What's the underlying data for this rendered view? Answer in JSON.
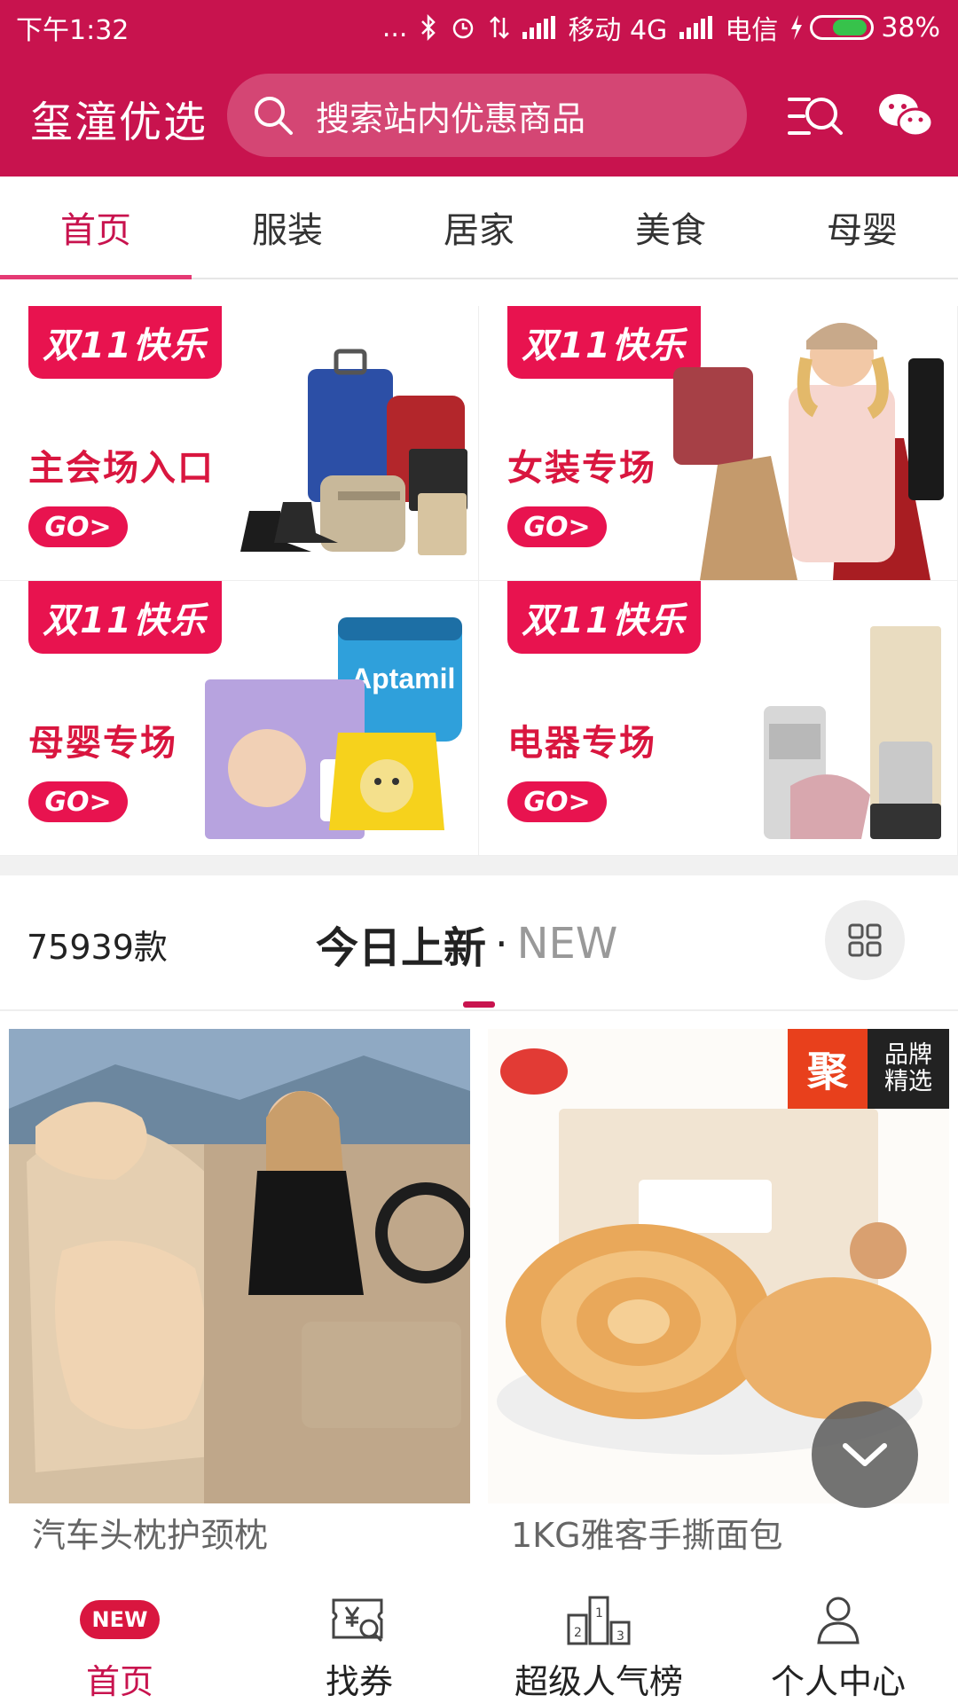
{
  "status_bar": {
    "time": "下午1:32",
    "dots": "...",
    "carrier1_net": "移动 4G",
    "carrier2": "电信",
    "battery": "38%",
    "battery_level": 0.38
  },
  "header": {
    "brand": "玺潼优选",
    "search_placeholder": "搜索站内优惠商品",
    "icons": [
      "search-icon",
      "filter-search-icon",
      "wechat-icon"
    ]
  },
  "tabs": [
    {
      "label": "首页",
      "active": true
    },
    {
      "label": "服装",
      "active": false
    },
    {
      "label": "居家",
      "active": false
    },
    {
      "label": "美食",
      "active": false
    },
    {
      "label": "母婴",
      "active": false
    }
  ],
  "banners": [
    {
      "badge": "双11快乐",
      "title": "主会场入口",
      "go": "GO>"
    },
    {
      "badge": "双11快乐",
      "title": "女装专场",
      "go": "GO>"
    },
    {
      "badge": "双11快乐",
      "title": "母婴专场",
      "go": "GO>"
    },
    {
      "badge": "双11快乐",
      "title": "电器专场",
      "go": "GO>"
    }
  ],
  "new_section": {
    "count": "75939款",
    "title_cn": "今日上新",
    "dot": "·",
    "title_en": "NEW"
  },
  "products": [
    {
      "title": "汽车头枕护颈枕"
    },
    {
      "title": "1KG雅客手撕面包",
      "tag_main": "聚",
      "tag_line1": "品牌",
      "tag_line2": "精选"
    }
  ],
  "bottom_nav": [
    {
      "label": "首页",
      "badge": "NEW",
      "active": true
    },
    {
      "label": "找券",
      "active": false
    },
    {
      "label": "超级人气榜",
      "active": false
    },
    {
      "label": "个人中心",
      "active": false
    }
  ],
  "colors": {
    "primary": "#c8134e",
    "accent": "#e8134f",
    "tab_underline": "#e53a74"
  }
}
